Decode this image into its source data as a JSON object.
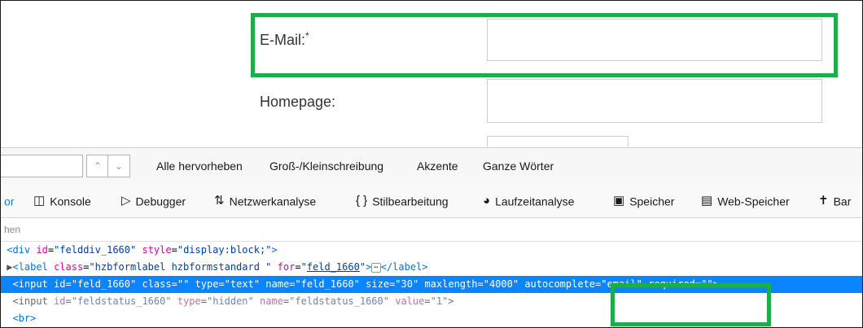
{
  "form": {
    "email_label": "E-Mail:",
    "email_required": "*",
    "homepage_label": "Homepage:"
  },
  "findbar": {
    "highlight_all": "Alle hervorheben",
    "match_case": "Groß-/Kleinschreibung",
    "diacritics": "Akzente",
    "whole_words": "Ganze Wörter"
  },
  "devtools": {
    "tabs": {
      "inspector": "or",
      "console": "Konsole",
      "debugger": "Debugger",
      "network": "Netzwerkanalyse",
      "style": "Stilbearbeitung",
      "performance": "Laufzeitanalyse",
      "memory": "Speicher",
      "storage": "Web-Speicher",
      "accessibility": "Bar"
    },
    "search_placeholder": "hen"
  },
  "code": {
    "line1": {
      "id": "felddiv_1660",
      "style": "display:block;"
    },
    "line2": {
      "class": "hzbformlabel hzbformstandard ",
      "for": "feld_1660"
    },
    "line3": {
      "id": "feld_1660",
      "class": "",
      "type": "text",
      "name": "feld_1660",
      "size": "30",
      "maxlength": "4000",
      "autocomplete": "email",
      "required": ""
    },
    "line4": {
      "id": "feldstatus_1660",
      "type": "hidden",
      "name": "feldstatus_1660",
      "value": "1"
    }
  },
  "colors": {
    "highlight_box": "#1cae4b",
    "selected_line": "#0a84ff"
  }
}
